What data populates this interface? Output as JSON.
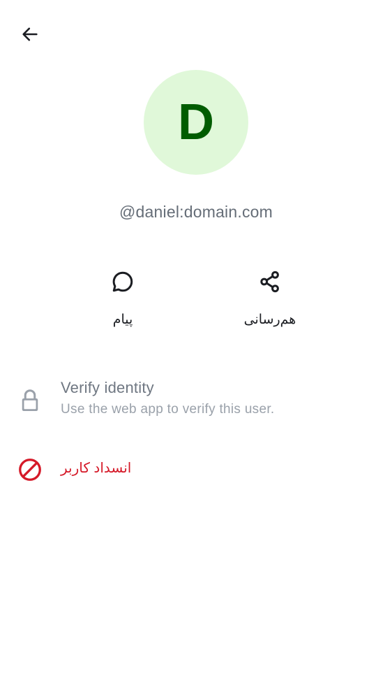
{
  "header": {
    "back_icon": "arrow-left-icon"
  },
  "profile": {
    "avatar_letter": "D",
    "avatar_bg": "#e0f8d9",
    "avatar_fg": "#005c00",
    "user_id": "@daniel:domain.com"
  },
  "actions": [
    {
      "label": "پیام",
      "icon": "chat-bubble-icon"
    },
    {
      "label": "هم‌رسانی",
      "icon": "share-icon"
    }
  ],
  "verify": {
    "icon": "lock-icon",
    "title": "Verify identity",
    "subtitle": "Use the web app to verify this user."
  },
  "block": {
    "icon": "block-icon",
    "label": "انسداد کاربر",
    "color": "#d51928"
  }
}
